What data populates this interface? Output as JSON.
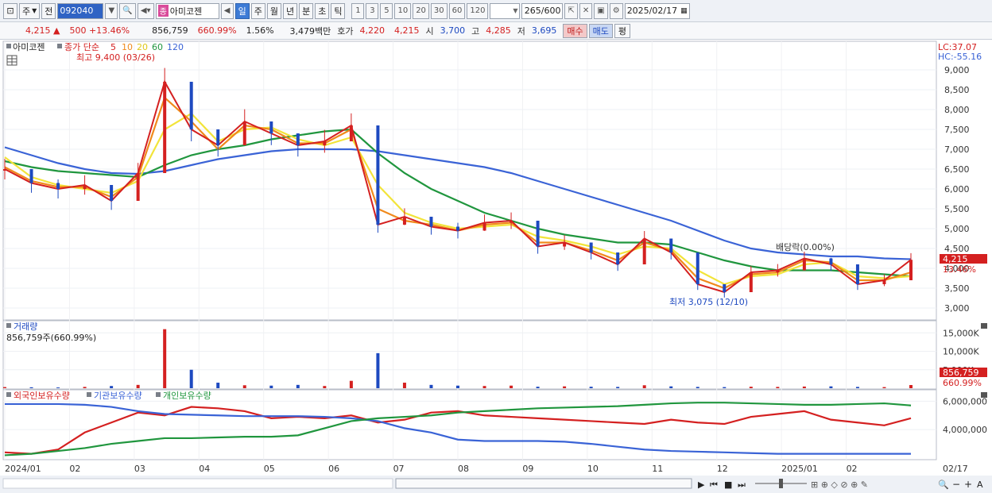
{
  "toolbar": {
    "type_label": "주",
    "jeon_label": "전",
    "stock_code": "092040",
    "stock_badge": "종",
    "stock_name": "아미코젠",
    "periods": [
      "일",
      "주",
      "월",
      "년",
      "분",
      "초",
      "틱"
    ],
    "active_period": "일",
    "intervals": [
      "1",
      "3",
      "5",
      "10",
      "20",
      "30",
      "60",
      "120"
    ],
    "count_value": "265",
    "count_total": "/600",
    "date_value": "2025/02/17"
  },
  "quote": {
    "price": "4,215",
    "change_arrow": "▲",
    "change": "500",
    "change_pct": "+13.46%",
    "volume": "856,759",
    "volume_pct": "660.99%",
    "turnover_pct": "1.56%",
    "trade_amount": "3,479백만",
    "hoga_label": "호가",
    "ask": "4,220",
    "bid": "4,215",
    "open_label": "시",
    "open": "3,700",
    "high_label": "고",
    "high": "4,285",
    "low_label": "저",
    "low": "3,695",
    "buy_label": "매수",
    "sell_label": "매도",
    "eval_label": "평"
  },
  "price_panel": {
    "name_tag": "아미코젠",
    "legend_prefix": "종가 단순",
    "ma_periods": [
      "5",
      "10",
      "20",
      "60",
      "120"
    ],
    "ma_colors": [
      "#d42020",
      "#f08a1c",
      "#f2e43a",
      "#20963e",
      "#3a63d6"
    ],
    "lc_label": "LC:37.07",
    "hc_label": "HC:-55.16",
    "high_marker": "최고 9,400 (03/26)",
    "low_marker": "최저 3,075 (12/10)",
    "dividend_label": "배당락(0.00%)",
    "last_price_tag": "4,215",
    "last_pct_tag": "13.46%"
  },
  "volume_panel": {
    "title": "거래량",
    "value_text": "856,759주(660.99%)",
    "last_value_tag": "856,759",
    "last_pct_tag": "660.99%"
  },
  "holding_panel": {
    "legend": [
      "외국인보유수량",
      "기관보유수량",
      "개인보유수량"
    ],
    "colors": [
      "#d42020",
      "#3a63d6",
      "#20963e"
    ]
  },
  "x_axis": {
    "labels": [
      "2024/01",
      "02",
      "03",
      "04",
      "05",
      "06",
      "07",
      "08",
      "09",
      "10",
      "11",
      "12",
      "2025/01",
      "02"
    ],
    "right_label": "02/17"
  },
  "chart_data": {
    "type": "line",
    "price_axis": {
      "ticks": [
        "9,000",
        "8,500",
        "8,000",
        "7,500",
        "7,000",
        "6,500",
        "6,000",
        "5,500",
        "5,000",
        "4,500",
        "4,000",
        "3,500",
        "3,000"
      ],
      "values": [
        9000,
        8500,
        8000,
        7500,
        7000,
        6500,
        6000,
        5500,
        5000,
        4500,
        4000,
        3500,
        3000
      ],
      "ylim": [
        2800,
        9600
      ]
    },
    "volume_axis": {
      "ticks": [
        "15,000K",
        "10,000K",
        "5,000K"
      ],
      "values": [
        15000,
        10000,
        5000
      ],
      "ylim": [
        0,
        17000
      ]
    },
    "holding_axis": {
      "ticks": [
        "6,000,000",
        "4,000,000"
      ],
      "values": [
        6000000,
        4000000
      ],
      "ylim": [
        2000000,
        6300000
      ]
    },
    "months": [
      "2024/01",
      "02",
      "03",
      "04",
      "05",
      "06",
      "07",
      "08",
      "09",
      "10",
      "11",
      "12",
      "2025/01",
      "02"
    ],
    "series": [
      {
        "name": "5",
        "values": [
          6500,
          6150,
          6000,
          6100,
          5700,
          6400,
          8700,
          7500,
          7100,
          7700,
          7400,
          7100,
          7200,
          7600,
          5100,
          5300,
          5050,
          4950,
          5150,
          5200,
          4550,
          4650,
          4400,
          4100,
          4750,
          4400,
          3600,
          3400,
          3900,
          3950,
          4250,
          4100,
          3600,
          3700,
          4215
        ]
      },
      {
        "name": "10",
        "values": [
          6550,
          6200,
          6050,
          6050,
          5800,
          6300,
          8300,
          7700,
          7000,
          7600,
          7500,
          7150,
          7150,
          7500,
          5500,
          5200,
          5100,
          4950,
          5100,
          5150,
          4650,
          4650,
          4450,
          4200,
          4650,
          4450,
          3750,
          3500,
          3850,
          3900,
          4200,
          4150,
          3700,
          3700,
          3900
        ]
      },
      {
        "name": "20",
        "values": [
          6800,
          6300,
          6100,
          6000,
          5900,
          6200,
          7500,
          7900,
          7200,
          7500,
          7550,
          7250,
          7100,
          7300,
          6100,
          5400,
          5150,
          5000,
          5050,
          5100,
          4800,
          4700,
          4550,
          4350,
          4550,
          4500,
          3950,
          3600,
          3800,
          3850,
          4100,
          4150,
          3800,
          3750,
          3800
        ]
      },
      {
        "name": "60",
        "values": [
          6700,
          6550,
          6450,
          6400,
          6350,
          6300,
          6600,
          6850,
          7000,
          7100,
          7250,
          7350,
          7450,
          7500,
          6900,
          6400,
          6000,
          5700,
          5400,
          5200,
          5000,
          4850,
          4750,
          4650,
          4650,
          4600,
          4400,
          4200,
          4050,
          3950,
          3950,
          3950,
          3900,
          3850,
          3800
        ]
      },
      {
        "name": "120",
        "values": [
          7050,
          6850,
          6650,
          6500,
          6400,
          6380,
          6450,
          6600,
          6750,
          6850,
          6950,
          7000,
          7000,
          7000,
          6950,
          6850,
          6750,
          6650,
          6550,
          6400,
          6200,
          6000,
          5800,
          5600,
          5400,
          5200,
          4950,
          4700,
          4500,
          4400,
          4350,
          4300,
          4300,
          4250,
          4230
        ]
      }
    ],
    "volume": [
      300,
      250,
      200,
      350,
      600,
      900,
      16000,
      5000,
      1500,
      800,
      700,
      900,
      600,
      2000,
      9500,
      1500,
      900,
      700,
      600,
      700,
      400,
      500,
      400,
      350,
      800,
      500,
      350,
      300,
      400,
      350,
      450,
      500,
      350,
      300,
      857
    ],
    "holdings": [
      {
        "name": "외국인보유수량",
        "values": [
          2400000,
          2300000,
          2600000,
          3800000,
          4500000,
          5200000,
          5000000,
          5600000,
          5500000,
          5300000,
          4800000,
          4900000,
          4800000,
          5000000,
          4500000,
          4700000,
          5200000,
          5300000,
          5000000,
          4900000,
          4800000,
          4700000,
          4600000,
          4500000,
          4400000,
          4700000,
          4500000,
          4400000,
          4900000,
          5100000,
          5300000,
          4700000,
          4500000,
          4300000,
          4800000
        ]
      },
      {
        "name": "기관보유수량",
        "values": [
          5800000,
          5800000,
          5800000,
          5750000,
          5600000,
          5300000,
          5100000,
          5050000,
          5000000,
          4950000,
          4950000,
          4950000,
          4900000,
          4800000,
          4600000,
          4100000,
          3800000,
          3300000,
          3200000,
          3200000,
          3200000,
          3150000,
          3000000,
          2800000,
          2600000,
          2500000,
          2450000,
          2400000,
          2350000,
          2300000,
          2300000,
          2300000,
          2300000,
          2300000,
          2300000
        ]
      },
      {
        "name": "개인보유수량",
        "values": [
          2200000,
          2300000,
          2500000,
          2700000,
          3000000,
          3200000,
          3400000,
          3400000,
          3450000,
          3500000,
          3500000,
          3600000,
          4100000,
          4600000,
          4800000,
          4900000,
          5000000,
          5200000,
          5300000,
          5400000,
          5500000,
          5550000,
          5600000,
          5650000,
          5750000,
          5850000,
          5900000,
          5900000,
          5850000,
          5800000,
          5750000,
          5750000,
          5800000,
          5850000,
          5700000
        ]
      }
    ]
  }
}
